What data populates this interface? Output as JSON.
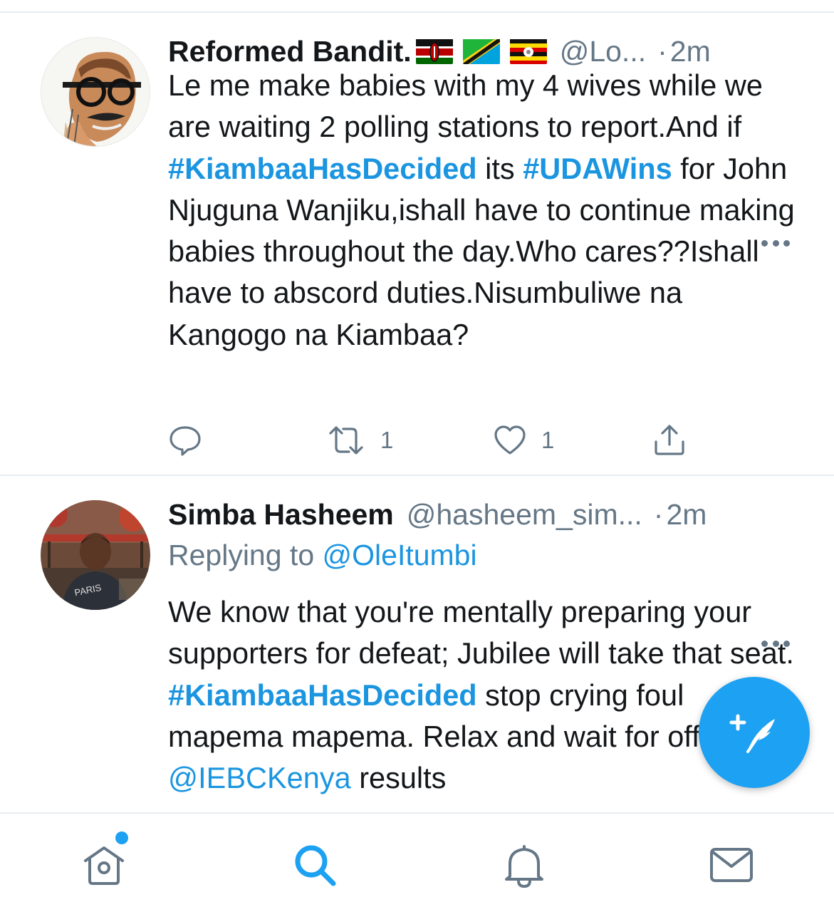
{
  "colors": {
    "link": "#1b95e0",
    "accent": "#1da1f2",
    "secondary_text": "#657786",
    "primary_text": "#14171a"
  },
  "tweets": [
    {
      "name": "Reformed Bandit.",
      "flags": [
        "kenya-flag",
        "tanzania-flag",
        "uganda-flag"
      ],
      "handle": "@Lo...",
      "dot": "·",
      "time": "2m",
      "text": {
        "p1": "Le me make babies with my 4 wives while we are waiting 2 polling stations to report.And if ",
        "tag1": "#KiambaaHasDecided",
        "p2": " its ",
        "tag2": "#UDAWins",
        "p3": " for John Njuguna Wanjiku,ishall have to continue making babies throughout the day.Who cares??Ishall have to abscord duties.Nisumbuliwe na Kangogo na Kiambaa?"
      },
      "actions": {
        "reply_count": "",
        "retweet_count": "1",
        "like_count": "1"
      }
    },
    {
      "name": "Simba Hasheem",
      "handle": "@hasheem_sim...",
      "dot": "·",
      "time": "2m",
      "replying_prefix": "Replying to ",
      "replying_to": "@OleItumbi",
      "text": {
        "p1": "We know that you're mentally preparing your supporters for defeat; Jubilee will take that seat. ",
        "tag1": "#KiambaaHasDecided",
        "p2": " stop crying foul mapema mapema. Relax and wait for official ",
        "mention1": "@IEBCKenya",
        "p3": "  results"
      }
    }
  ],
  "bottom_nav": {
    "items": [
      "home-icon",
      "search-icon",
      "notifications-icon",
      "messages-icon"
    ],
    "active": "search-icon",
    "home_has_new": true
  },
  "fab": {
    "icon": "compose-tweet-icon"
  }
}
